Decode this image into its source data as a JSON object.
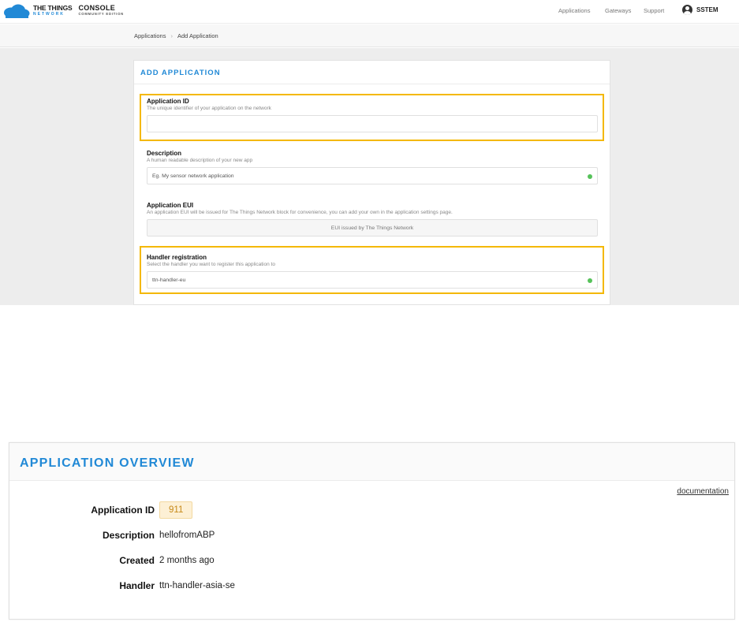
{
  "topnav": {
    "brand_line1": "THE THINGS",
    "brand_line2": "NETWORK",
    "console_line1": "CONSOLE",
    "console_line2": "COMMUNITY EDITION",
    "links": [
      "Applications",
      "Gateways",
      "Support"
    ],
    "user": "SSTEM"
  },
  "breadcrumb": {
    "items": [
      "Applications",
      "Add Application"
    ],
    "separator": "›"
  },
  "add_app": {
    "title": "ADD APPLICATION",
    "fields": [
      {
        "label": "Application ID",
        "hint": "The unique identifier of your application on the network",
        "value": "",
        "placeholder": ""
      },
      {
        "label": "Description",
        "hint": "A human readable description of your new app",
        "value": "",
        "placeholder": "Eg. My sensor network application"
      },
      {
        "label": "Application EUI",
        "hint": "An application EUI will be issued for The Things Network block for convenience, you can add your own in the application settings page.",
        "value": "EUI issued by The Things Network"
      },
      {
        "label": "Handler registration",
        "hint": "Select the handler you want to register this application to",
        "value": "ttn-handler-eu"
      }
    ],
    "highlight_color": "#f4b800"
  },
  "overview": {
    "title": "APPLICATION OVERVIEW",
    "doc_link": "documentation",
    "rows": [
      {
        "label": "Application ID",
        "value": "911"
      },
      {
        "label": "Description",
        "value": "hellofromABP"
      },
      {
        "label": "Created",
        "value": "2 months ago"
      },
      {
        "label": "Handler",
        "value": "ttn-handler-asia-se"
      }
    ]
  },
  "colors": {
    "accent": "#2189d6",
    "highlight": "#f4b800",
    "valid": "#56c25a"
  }
}
